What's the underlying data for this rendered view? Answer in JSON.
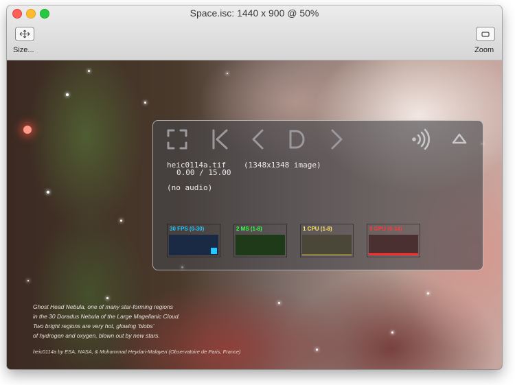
{
  "window": {
    "title": "Space.isc: 1440 x 900 @ 50%"
  },
  "toolbar": {
    "size_label": "Size...",
    "zoom_label": "Zoom"
  },
  "hud": {
    "file_name": "heic0114a.tif",
    "image_info": "(1348x1348 image)",
    "time": "0.00 / 15.00",
    "audio": "(no audio)",
    "controls": [
      "fullscreen-icon",
      "skip-to-start-icon",
      "previous-icon",
      "play-icon",
      "next-icon",
      "airplay-audio-icon",
      "eject-icon"
    ],
    "meters": [
      {
        "label": "30 FPS (0-30)",
        "color": "#25c7ff",
        "fill": "#1a2a45"
      },
      {
        "label": "2 MS (1-8)",
        "color": "#39ff4a",
        "fill": "#1f3a18"
      },
      {
        "label": "1 CPU (1-8)",
        "color": "#ffe86a",
        "fill": "#4a4638"
      },
      {
        "label": "9 GPU (6-14)",
        "color": "#ff3a3a",
        "fill": "#4a3030"
      }
    ]
  },
  "caption": {
    "line1": "Ghost Head Nebula, one of many star-forming regions",
    "line2": "in the 30 Doradus Nebula of the Large Magellanic Cloud.",
    "line3": "Two bright regions are very hot, glowing ‘blobs’",
    "line4": "of hydrogen and oxygen, blown out by new stars.",
    "credit": "heic0114a by ESA, NASA, & Mohammad Heydari-Malayeri (Observatoire de Paris, France)"
  }
}
